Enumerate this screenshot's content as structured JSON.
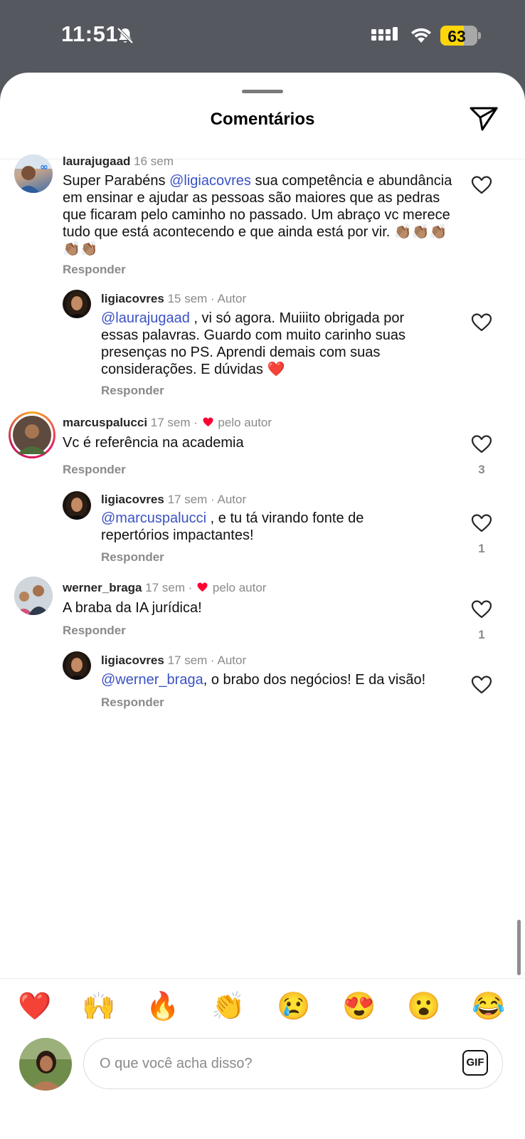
{
  "status_bar": {
    "time": "11:51",
    "battery": "63",
    "battery_level": 0.63
  },
  "sheet": {
    "title": "Comentários"
  },
  "comments": [
    {
      "username": "laurajugaad",
      "time": "16 sem",
      "text_before": "Super Parabéns ",
      "mention": "@ligiacovres",
      "text_after": " sua competência e abundância em ensinar e ajudar as pessoas são maiores que as pedras que ficaram pelo caminho no passado. Um abraço vc merece tudo que está acontecendo e que ainda está por vir. 👏🏽👏🏽👏🏽👏🏽👏🏽",
      "reply_label": "Responder"
    },
    {
      "username": "ligiacovres",
      "time": "15 sem",
      "badge": "· Autor",
      "mention": "@laurajugaad",
      "text_after": " , vi só agora. Muiiito obrigada por essas palavras. Guardo com muito carinho suas presenças no PS. Aprendi demais com suas considerações. E dúvidas ❤️",
      "reply_label": "Responder"
    },
    {
      "username": "marcuspalucci",
      "time": "17 sem",
      "liked_by": "pelo autor",
      "text": "Vc é referência na academia",
      "reply_label": "Responder",
      "likes": "3"
    },
    {
      "username": "ligiacovres",
      "time": "17 sem",
      "badge": "· Autor",
      "mention": "@marcuspalucci",
      "text_after": " , e tu tá virando fonte de repertórios impactantes!",
      "reply_label": "Responder",
      "likes": "1"
    },
    {
      "username": "werner_braga",
      "time": "17 sem",
      "liked_by": "pelo autor",
      "text": "A braba da IA jurídica!",
      "reply_label": "Responder",
      "likes": "1"
    },
    {
      "username": "ligiacovres",
      "time": "17 sem",
      "badge": "· Autor",
      "mention": "@werner_braga",
      "text_after": ", o brabo dos negócios! E da visão!",
      "reply_label": "Responder"
    }
  ],
  "reactions": [
    "❤️",
    "🙌",
    "🔥",
    "👏",
    "😢",
    "😍",
    "😮",
    "😂"
  ],
  "composer": {
    "placeholder": "O que você acha disso?",
    "gif_label": "GIF"
  },
  "colors": {
    "mention": "#3b52c4",
    "heart": "#ff0033",
    "status_bar": "#55595f",
    "battery": "#ffd60a"
  }
}
